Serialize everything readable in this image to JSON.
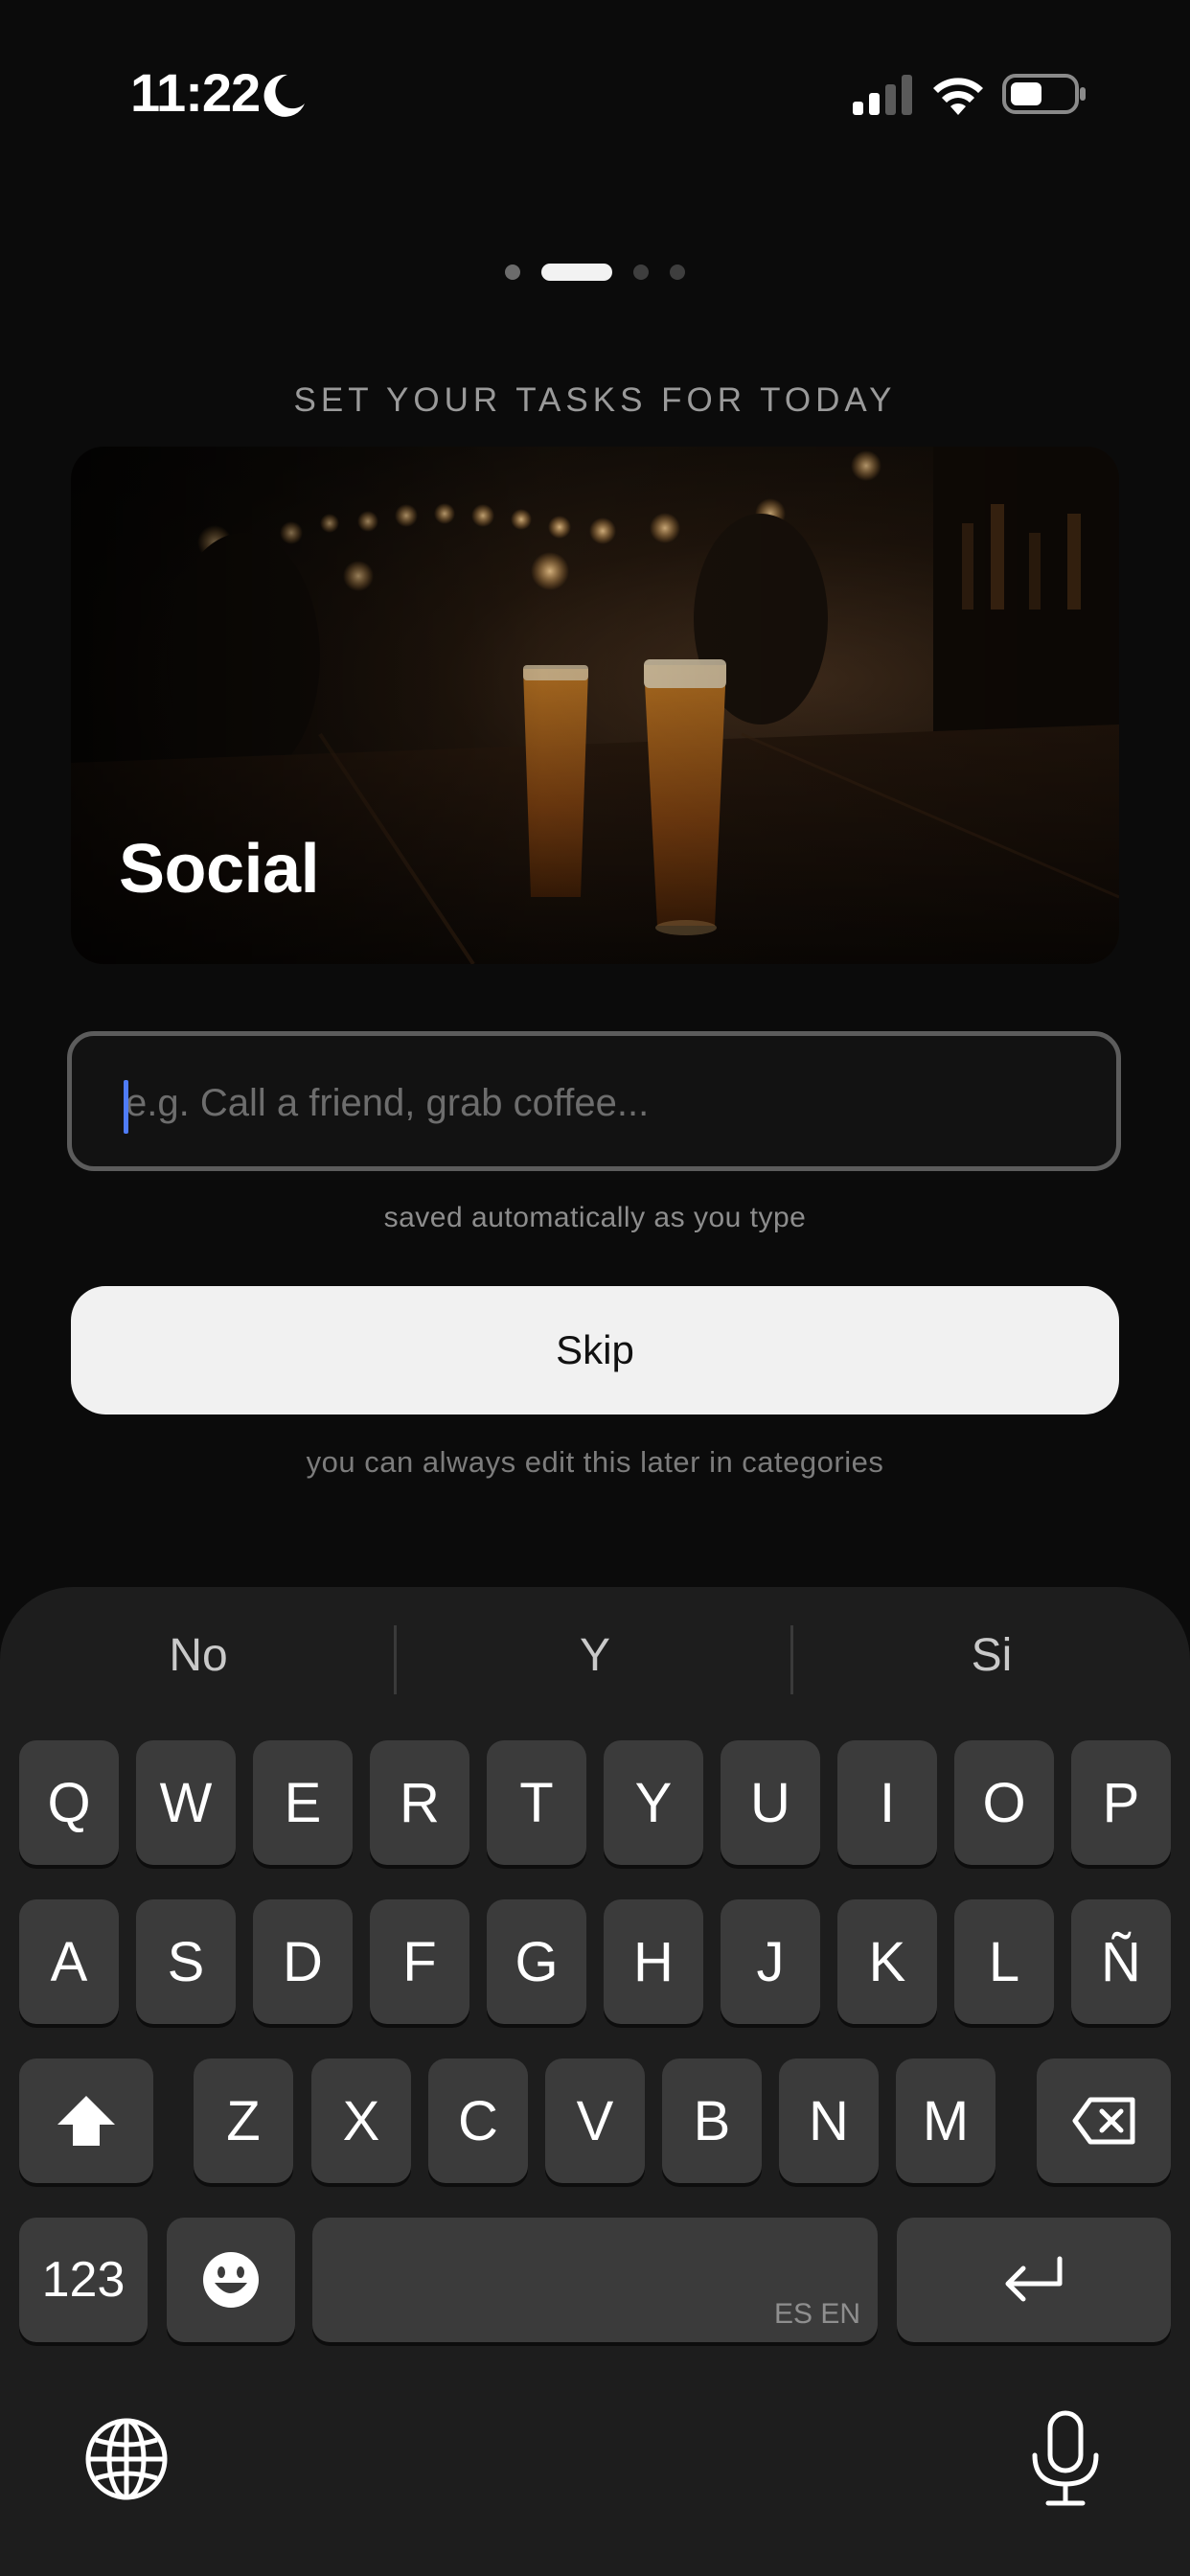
{
  "status_bar": {
    "time": "11:22",
    "icons": [
      "moon-icon",
      "cellular-signal-icon",
      "wifi-icon",
      "battery-icon"
    ]
  },
  "pager": {
    "count": 4,
    "active_index": 1
  },
  "title": "SET YOUR TASKS FOR TODAY",
  "category_card": {
    "label": "Social",
    "image": "bar-with-two-beers-photo"
  },
  "task_input": {
    "value": "",
    "placeholder": "e.g. Call a friend, grab coffee...",
    "caret_color": "#4f7cf7"
  },
  "autosave_hint": "saved automatically as you type",
  "skip_button": {
    "label": "Skip"
  },
  "edit_hint": "you can always edit this later in categories",
  "keyboard": {
    "suggestions": [
      "No",
      "Y",
      "Si"
    ],
    "row1": [
      "Q",
      "W",
      "E",
      "R",
      "T",
      "Y",
      "U",
      "I",
      "O",
      "P"
    ],
    "row2": [
      "A",
      "S",
      "D",
      "F",
      "G",
      "H",
      "J",
      "K",
      "L",
      "Ñ"
    ],
    "row3": [
      "Z",
      "X",
      "C",
      "V",
      "B",
      "N",
      "M"
    ],
    "numbers_key": "123",
    "space_languages": "ES EN",
    "icons": [
      "shift-icon",
      "backspace-icon",
      "emoji-icon",
      "return-icon",
      "globe-icon",
      "microphone-icon"
    ]
  },
  "colors": {
    "background": "#0b0b0b",
    "button": "#f1f1f1",
    "keyboard": "#1d1d1d",
    "key": "#3b3b3b"
  }
}
